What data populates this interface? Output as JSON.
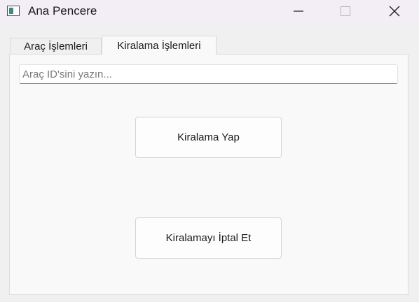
{
  "window": {
    "title": "Ana Pencere",
    "controls": {
      "minimize_icon": "minimize-icon",
      "maximize_icon": "maximize-icon",
      "close_icon": "close-icon"
    }
  },
  "tabs": [
    {
      "label": "Araç İşlemleri",
      "active": false
    },
    {
      "label": "Kiralama İşlemleri",
      "active": true
    }
  ],
  "rental_panel": {
    "search": {
      "placeholder": "Araç ID'sini yazın...",
      "value": ""
    },
    "rent_button_label": "Kiralama Yap",
    "cancel_button_label": "Kiralamayı İptal Et"
  },
  "colors": {
    "titlebar_bg": "#f3eef5",
    "window_bg": "#f0f0f0",
    "panel_bg": "#f9f9f9",
    "app_icon_accent": "#3f8a7f"
  }
}
